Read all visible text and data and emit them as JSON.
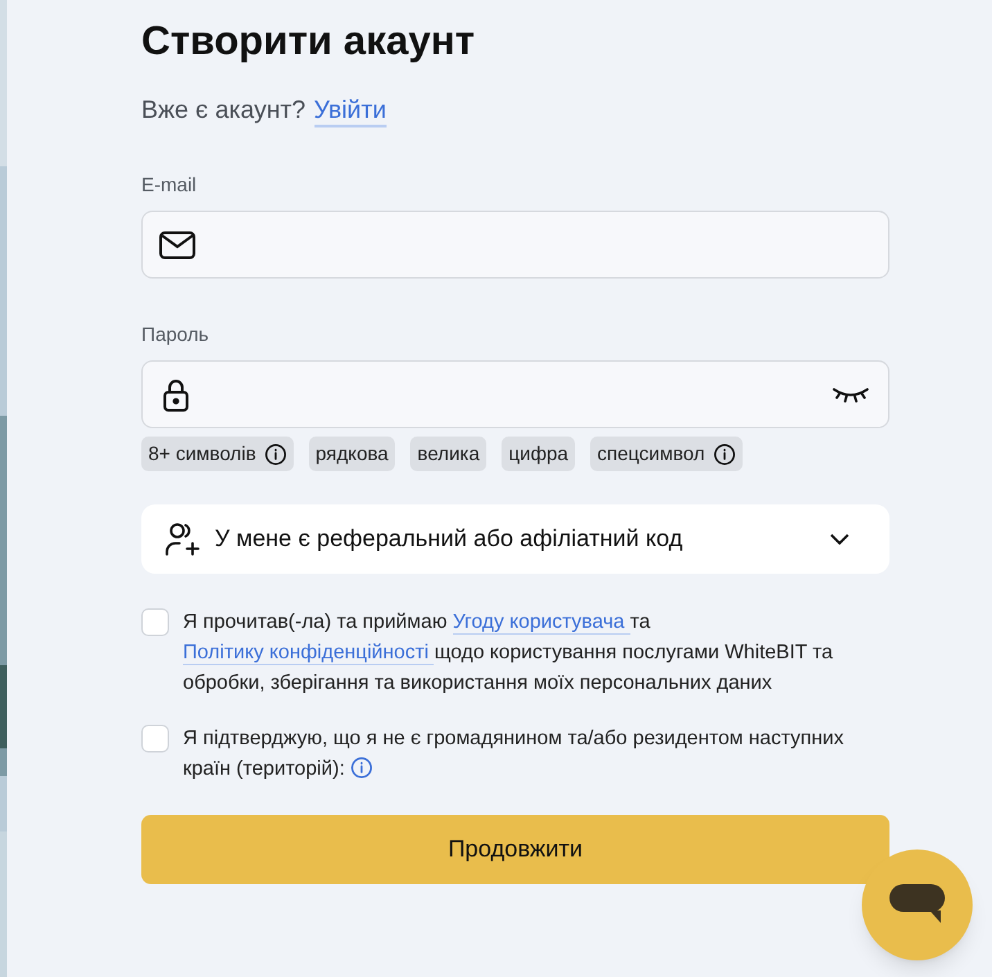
{
  "title": "Створити акаунт",
  "login_prompt": {
    "text": "Вже є акаунт?",
    "link": "Увійти"
  },
  "email": {
    "label": "E-mail"
  },
  "password": {
    "label": "Пароль",
    "visible": false
  },
  "requirements": [
    {
      "label": "8+ символів",
      "info": true
    },
    {
      "label": "рядкова",
      "info": false
    },
    {
      "label": "велика",
      "info": false
    },
    {
      "label": "цифра",
      "info": false
    },
    {
      "label": "спецсимвол",
      "info": true
    }
  ],
  "referral": {
    "label": "У мене є реферальний або афіліатний код",
    "expanded": false
  },
  "consents": [
    {
      "checked": false,
      "info": false,
      "parts": [
        {
          "kind": "text",
          "text": "Я прочитав(-ла) та приймаю"
        },
        {
          "kind": "link",
          "text": "Угоду користувача"
        },
        {
          "kind": "text",
          "text": "та"
        },
        {
          "kind": "link",
          "text": "Політику конфіденційності"
        },
        {
          "kind": "text",
          "text": "щодо користування послугами WhiteBIT та обробки, зберігання та використання моїх персональних даних"
        }
      ]
    },
    {
      "checked": false,
      "info": true,
      "parts": [
        {
          "kind": "text",
          "text": "Я підтверджую, що я не є громадянином та/або резидентом наступних країн (територій):"
        }
      ]
    }
  ],
  "submit": "Продовжити"
}
